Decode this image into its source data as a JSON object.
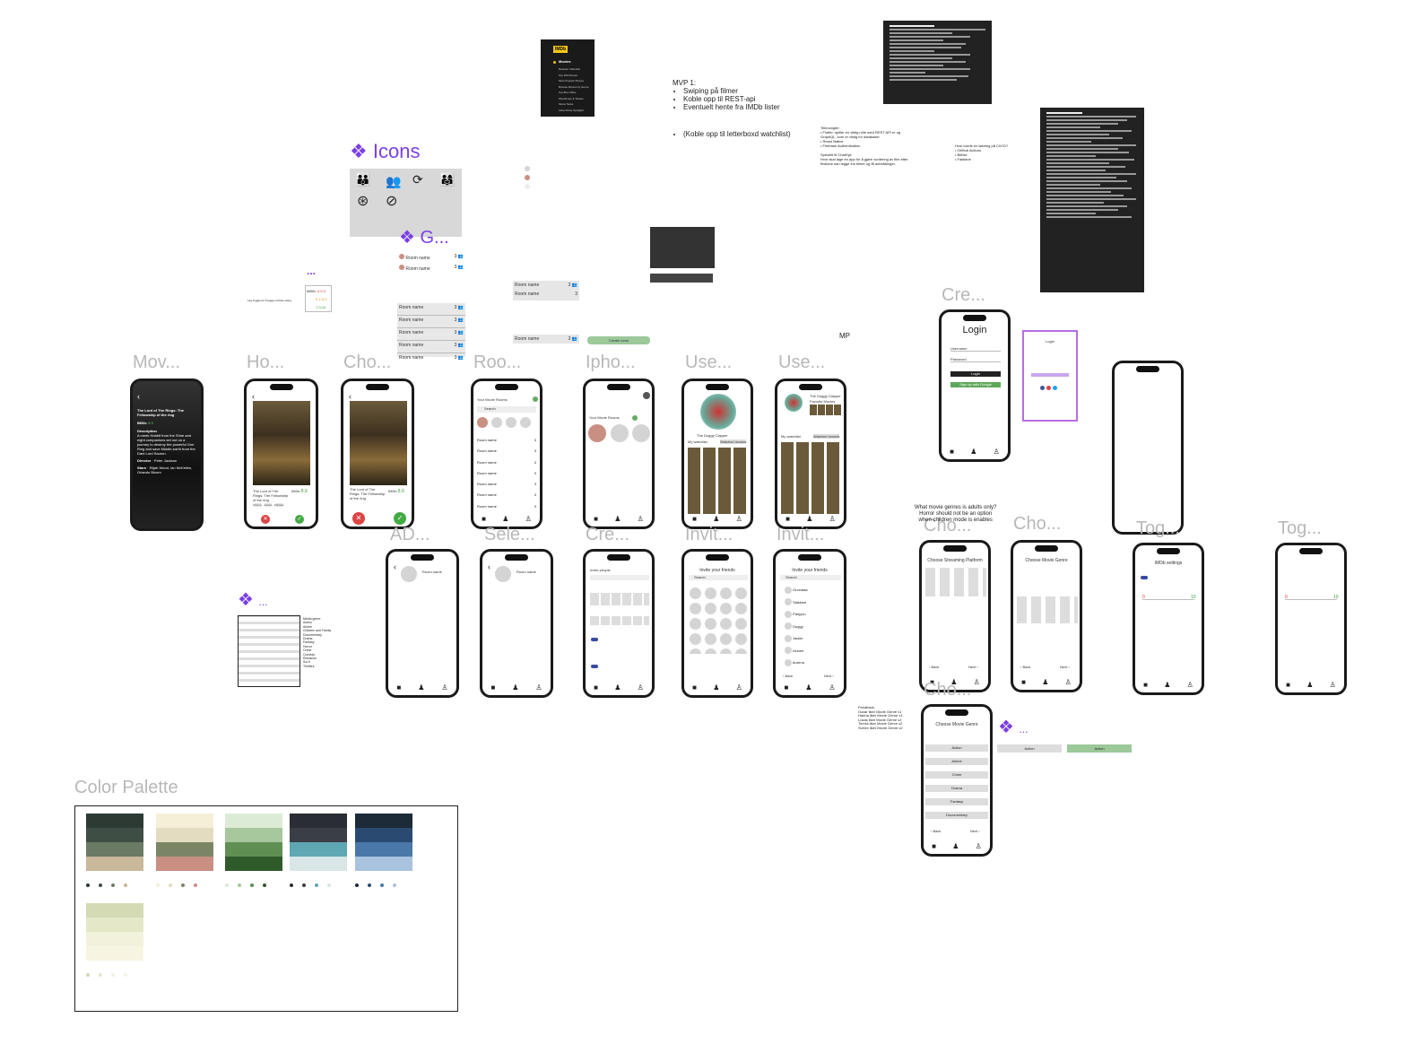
{
  "icons_section": {
    "title": "Icons"
  },
  "g_section": {
    "title": "G..."
  },
  "dots_label": "...",
  "imdb": {
    "logo": "IMDb",
    "menu_title": "Movies",
    "items": [
      "Release Calendar",
      "Top 250 Movies",
      "Most Popular Movies",
      "Browse Movies by Genre",
      "Top Box Office",
      "Showtimes & Tickets",
      "Movie News",
      "India Movie Spotlight"
    ]
  },
  "mvp": {
    "title": "MVP 1:",
    "bullets": [
      "Swiping på filmer",
      "Koble opp til REST-api",
      "Eventuelt hente fra IMDb lister"
    ],
    "extra": "(Koble opp til letterboxd watchlist)"
  },
  "frames": {
    "mov": "Mov...",
    "ho": "Ho...",
    "cho": "Cho...",
    "roo": "Roo...",
    "ipho": "Ipho...",
    "use1": "Use...",
    "use2": "Use...",
    "cre_login": "Cre...",
    "ad": "AD...",
    "sele": "Sele...",
    "cre2": "Cre...",
    "invit1": "Invit...",
    "invit2": "Invit...",
    "cho2": "Cho...",
    "cho3": "Cho...",
    "tog1": "Tog...",
    "tog2": "Tog...",
    "cho4": "Cho..."
  },
  "movie": {
    "title": "The Lord of The Rings: The Fellowship of the ring",
    "imdb_label": "IMDb:",
    "imdb_score": "8.9",
    "description_label": "Description",
    "description": "A meek Hobbit from the Shire and eight companions set out on a journey to destroy the powerful One Ring and save Middle-earth from the Dark Lord Sauron.",
    "director_label": "Director",
    "director": "Peter Jackson",
    "stars_label": "Stars",
    "stars": "Elijah Wood, Ian McKellen, Orlando Bloom"
  },
  "home": {
    "movie_title": "The Lord of The Rings: The Fellowship of the ring",
    "imdb": "IMDb",
    "score": "8.9",
    "tags": [
      "Drama",
      "Action",
      "Fantasy"
    ]
  },
  "room_list": {
    "header": "Your Movie Rooms",
    "search": "Search",
    "room": "Room name",
    "count": "3"
  },
  "your_movie_rooms": "Your Movie Rooms",
  "user_profile": {
    "name": "The Duggy Clapper",
    "tab_watchlist": "My watchlist",
    "tab_watched": "Watched movies",
    "fav": "Favorite Movies"
  },
  "login": {
    "title": "Login",
    "username": "Username",
    "password": "Password",
    "button": "Login",
    "signup": "Sign up with Google"
  },
  "login_small": {
    "title": "Login"
  },
  "room_name": "Room name",
  "invite": {
    "title": "Invite your friends",
    "search": "Search",
    "back": "Back",
    "next": "Next"
  },
  "invite_people": "Invite people",
  "friends": [
    "Gunnaaa",
    "Slakkeel",
    "Panjyuu",
    "Duggy",
    "Jackie",
    "Idunee",
    "Aurena"
  ],
  "streaming": {
    "title": "Choose Streaming Platform",
    "back": "Back",
    "next": "Next"
  },
  "genre": {
    "title": "Choose Movie Genre",
    "back": "Back",
    "next": "Next",
    "list": [
      "Action",
      "Anime",
      "Crime",
      "Drama",
      "Fantasy",
      "Documentary"
    ]
  },
  "imdb_settings": {
    "title": "IMDb settings",
    "min": "0",
    "max": "10"
  },
  "rating_box": {
    "label": "IMDb:",
    "a": "0-5.0",
    "b": "5.1-6.9",
    "c": "7.0-10"
  },
  "toggle_note": "Lag Toggle for å legge inn/rate rating",
  "adults_note": "What movie genres is adults only?\nHorror should not be an option\nwhen children mode is enables",
  "feedback_note": "Feedback:\nOzzar liker Movie Genre v1\nHanna liker Movie Genre v1\nLukas liker Movie Genre v2\nTonnis liker Movie Genre v2\nSverre liker Movie Genre v2",
  "action_buttons": {
    "a": "Action",
    "b": "Action"
  },
  "create_room": "Create room",
  "mp": "MP",
  "technology_note": "Teknologier:\n• Flutter: spiller en viktig rolle med REST API er og GraphQL, som er viktig for databaser\n• React Native\n• Firebase Authentication\n\nSpesielt til ChatGpt:\nHvor skal lage en app for å gjøre vurdering av film etter. Brukere kan legge inn filmer og få anbefalinger.",
  "ci_note": "Hvor burde en løsning på CI/CD?\n• GitHub Actions\n• Bitrise\n• Fastlane",
  "palette": {
    "title": "Color Palette",
    "groups": [
      {
        "colors": [
          "#2d3a34",
          "#3f4e45",
          "#6a7a64",
          "#c9b89a"
        ]
      },
      {
        "colors": [
          "#f5efd8",
          "#e4dcc0",
          "#7c8466",
          "#c98f82"
        ]
      },
      {
        "colors": [
          "#dcebd6",
          "#a7c79c",
          "#5f8f52",
          "#2f5a2a"
        ]
      },
      {
        "colors": [
          "#2a2d33",
          "#3a3f46",
          "#5fa7b3",
          "#d8e6e8"
        ]
      },
      {
        "colors": [
          "#1d2a38",
          "#2a4a72",
          "#4a78a8",
          "#a9c2de"
        ]
      },
      {
        "colors": [
          "#d3dab4",
          "#e4e8c8",
          "#f2f2dc",
          "#f8f4e2"
        ]
      }
    ]
  },
  "genres_box": {
    "title": "Media genre",
    "items": [
      "Action",
      "Anime",
      "Children and Family",
      "Documentary",
      "Drama",
      "Fantasy",
      "Horror",
      "Crime",
      "Comedy",
      "Romance",
      "Sci-fi",
      "Thrillers"
    ]
  }
}
